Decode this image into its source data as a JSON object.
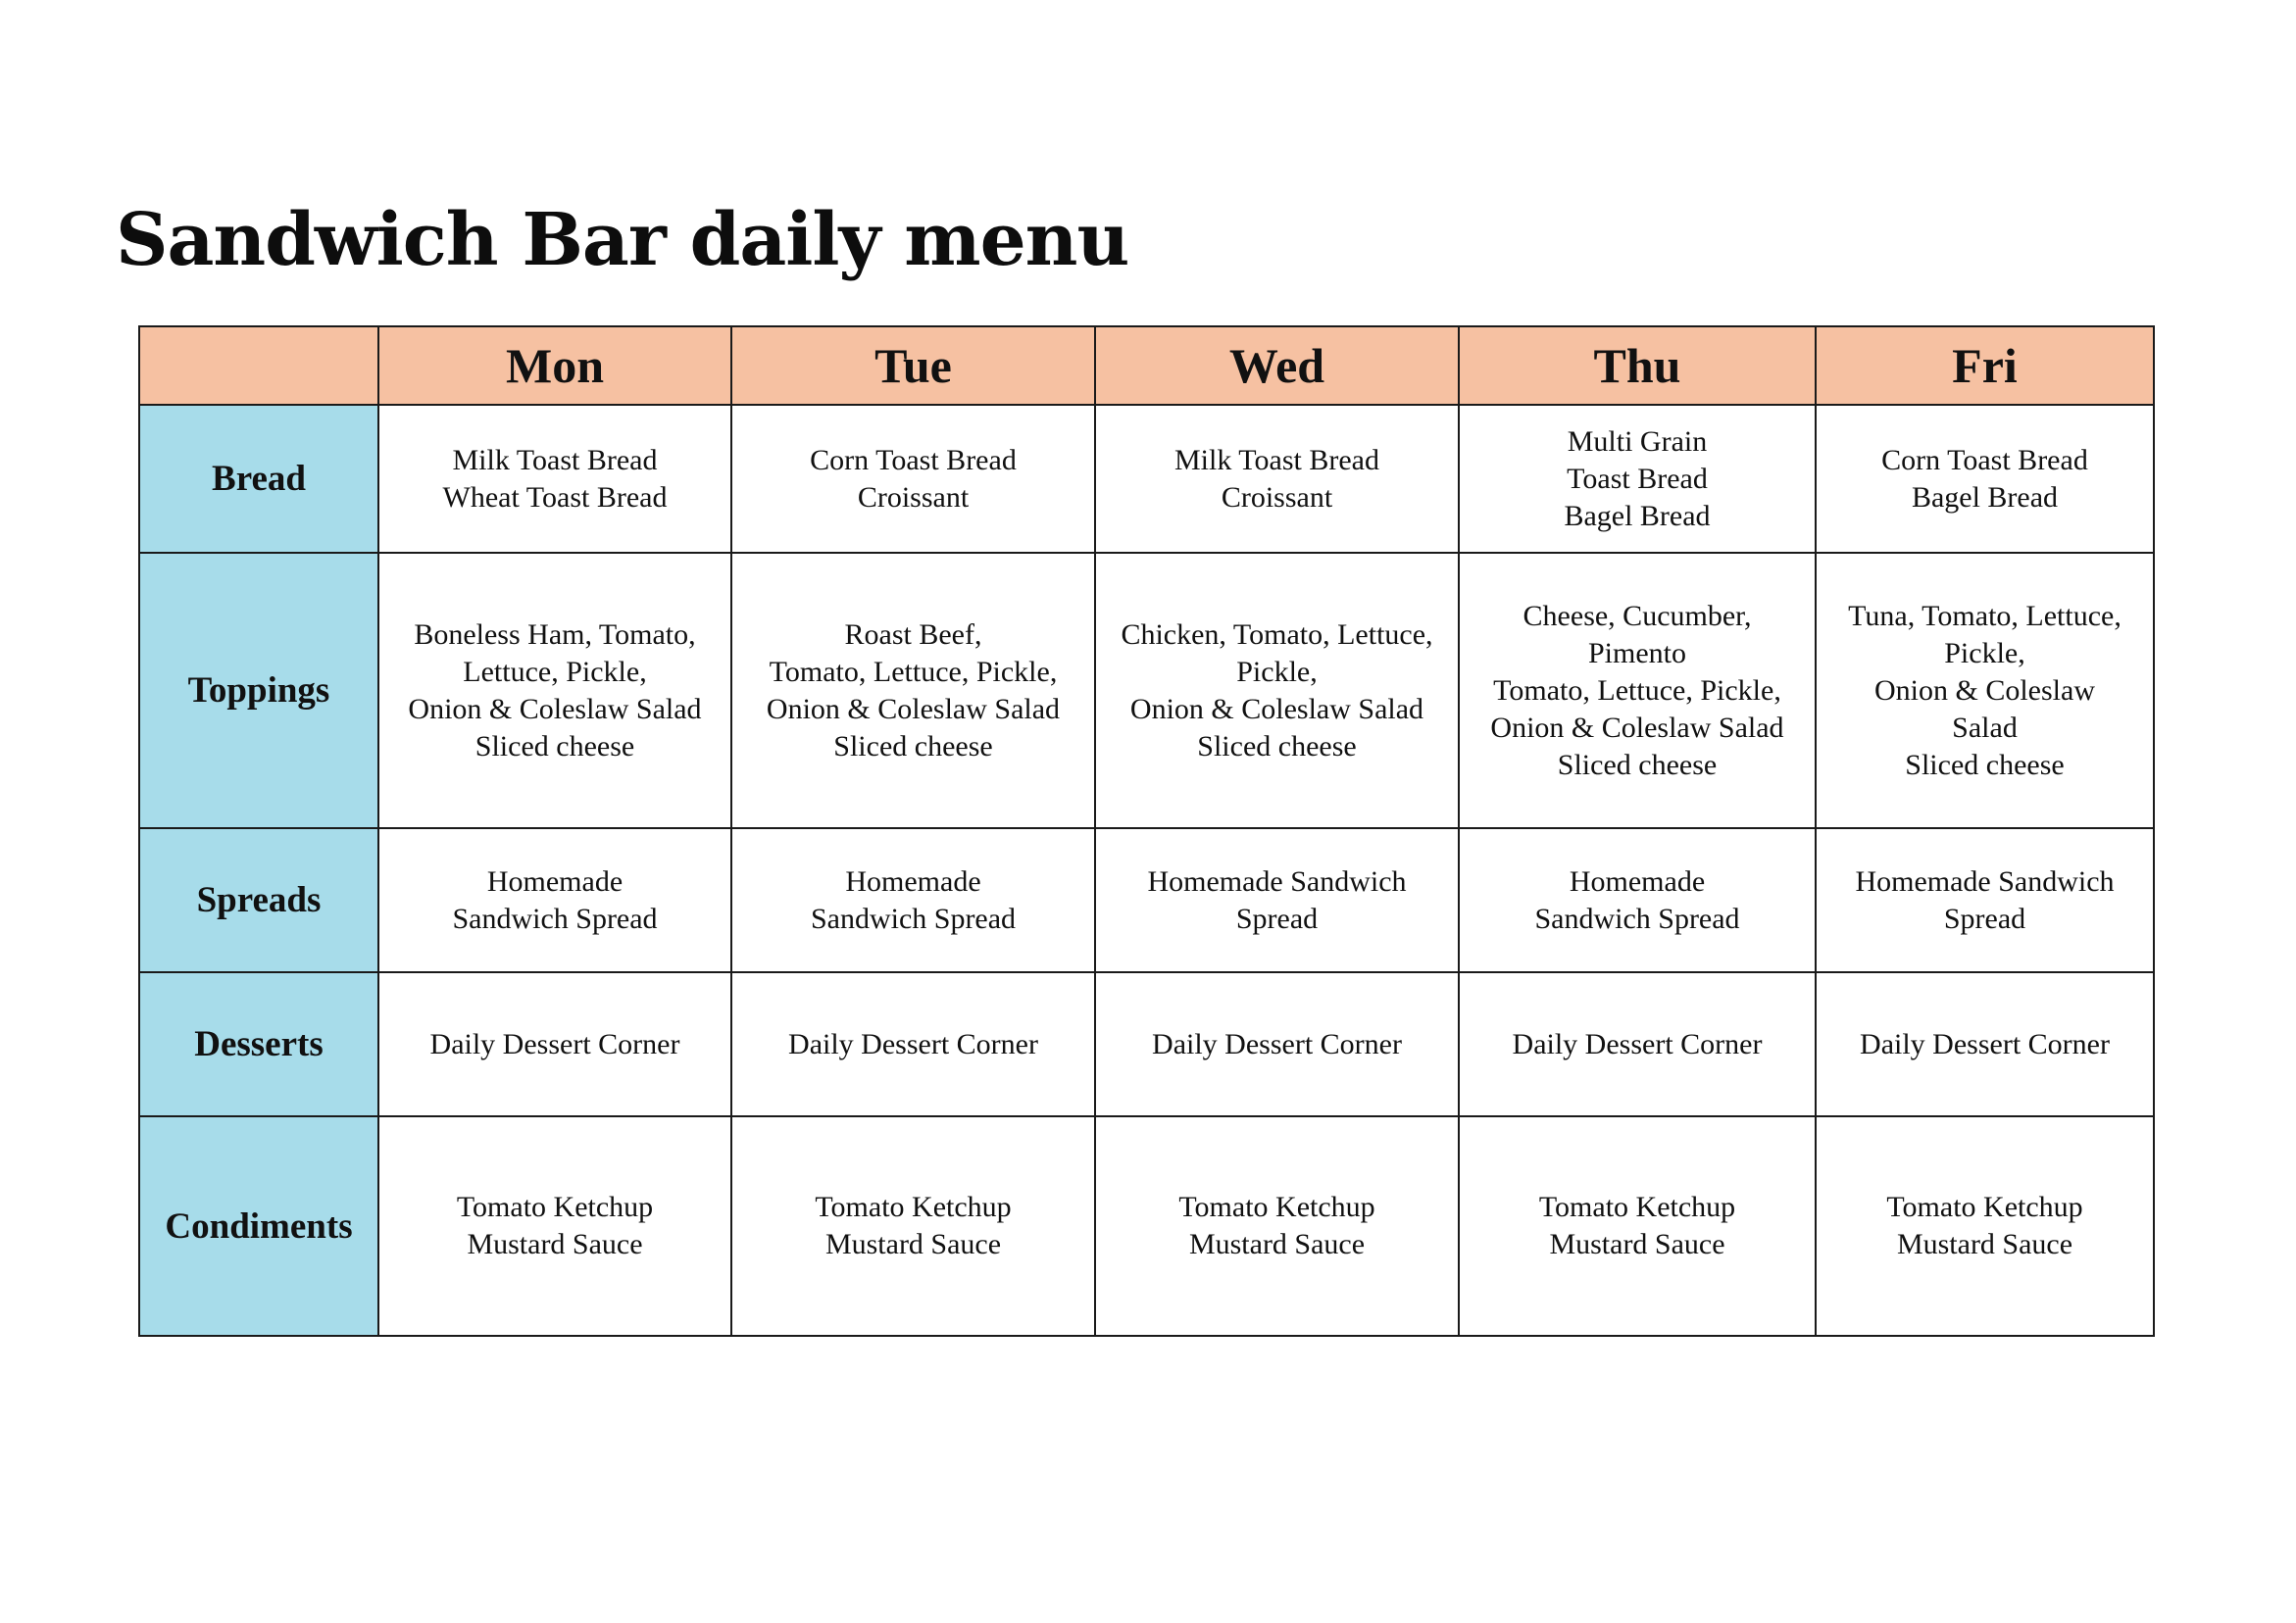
{
  "title": "Sandwich Bar daily menu",
  "days": [
    "Mon",
    "Tue",
    "Wed",
    "Thu",
    "Fri"
  ],
  "rows": [
    {
      "category": "Bread",
      "cells": [
        "Milk Toast Bread\nWheat Toast Bread",
        "Corn Toast Bread\nCroissant",
        "Milk Toast Bread\nCroissant",
        "Multi Grain\nToast Bread\nBagel Bread",
        "Corn Toast Bread\nBagel Bread"
      ]
    },
    {
      "category": "Toppings",
      "cells": [
        "Boneless Ham, Tomato,\nLettuce, Pickle,\nOnion & Coleslaw Salad\nSliced cheese",
        "Roast Beef,\nTomato, Lettuce, Pickle,\nOnion & Coleslaw Salad\nSliced cheese",
        "Chicken, Tomato, Lettuce,\nPickle,\nOnion & Coleslaw Salad\nSliced cheese",
        "Cheese, Cucumber,\nPimento\nTomato, Lettuce, Pickle,\nOnion & Coleslaw Salad\nSliced cheese",
        "Tuna, Tomato, Lettuce,\nPickle,\nOnion & Coleslaw\nSalad\nSliced cheese"
      ]
    },
    {
      "category": "Spreads",
      "cells": [
        "Homemade\nSandwich Spread",
        "Homemade\nSandwich Spread",
        "Homemade Sandwich\nSpread",
        "Homemade\nSandwich Spread",
        "Homemade Sandwich\nSpread"
      ]
    },
    {
      "category": "Desserts",
      "cells": [
        "Daily Dessert Corner",
        "Daily Dessert Corner",
        "Daily Dessert Corner",
        "Daily Dessert Corner",
        "Daily Dessert Corner"
      ]
    },
    {
      "category": "Condiments",
      "cells": [
        "Tomato Ketchup\nMustard Sauce",
        "Tomato Ketchup\nMustard Sauce",
        "Tomato Ketchup\nMustard Sauce",
        "Tomato Ketchup\nMustard Sauce",
        "Tomato Ketchup\nMustard Sauce"
      ]
    }
  ],
  "colors": {
    "header_bg": "#f6c1a2",
    "category_bg": "#a7dcea",
    "border": "#1a1a1a"
  }
}
